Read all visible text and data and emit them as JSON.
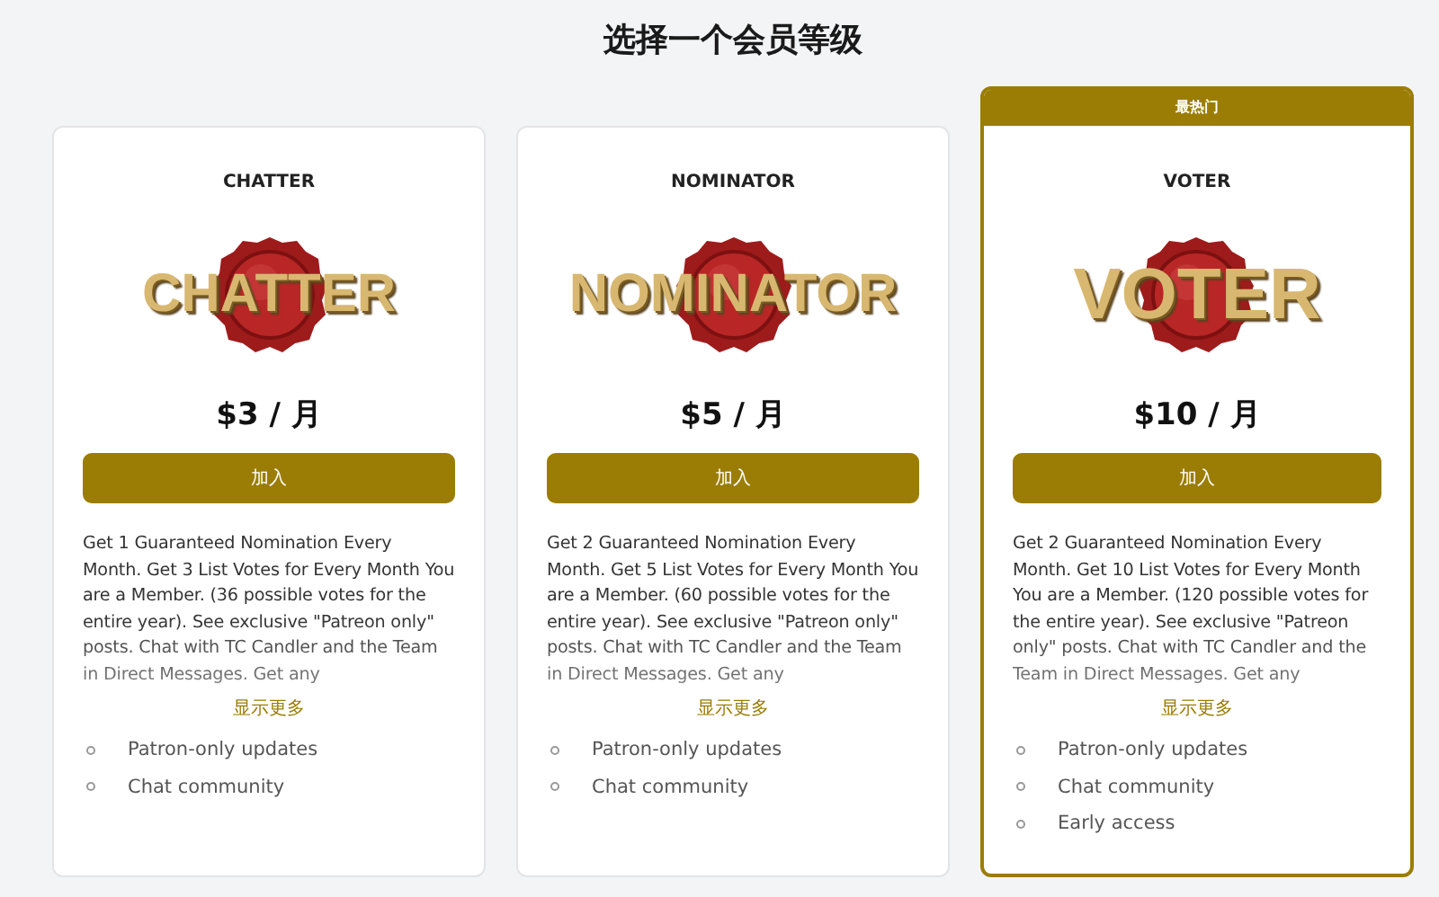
{
  "heading": "选择一个会员等级",
  "tiers": [
    {
      "name": "CHATTER",
      "emblem_text": "CHATTER",
      "price": "$3 / 月",
      "button": "加入",
      "featured": false,
      "description": "Get 1 Guaranteed Nomination Every Month. Get 3 List Votes for Every Month You are a Member. (36 possible votes for the entire year). See exclusive \"Patreon only\" posts. Chat with TC Candler and the Team in Direct Messages.  Get any",
      "show_more": "显示更多",
      "features": [
        "Patron-only updates",
        "Chat community"
      ]
    },
    {
      "name": "NOMINATOR",
      "emblem_text": "NOMINATOR",
      "price": "$5 / 月",
      "button": "加入",
      "featured": false,
      "description": "Get 2 Guaranteed Nomination Every Month. Get 5 List Votes for Every Month You are a Member. (60 possible votes for the entire year). See exclusive \"Patreon only\" posts. Chat with TC Candler and the Team in Direct Messages.  Get any",
      "show_more": "显示更多",
      "features": [
        "Patron-only updates",
        "Chat community"
      ]
    },
    {
      "name": "VOTER",
      "emblem_text": "VOTER",
      "price": "$10 / 月",
      "button": "加入",
      "featured": true,
      "badge": "最热门",
      "description": "Get 2 Guaranteed Nomination Every Month. Get 10 List Votes for Every Month You are a Member. (120 possible votes for the entire year). See exclusive \"Patreon only\" posts. Chat with TC Candler and the Team in Direct Messages.  Get any",
      "show_more": "显示更多",
      "features": [
        "Patron-only updates",
        "Chat community",
        "Early access"
      ]
    }
  ]
}
